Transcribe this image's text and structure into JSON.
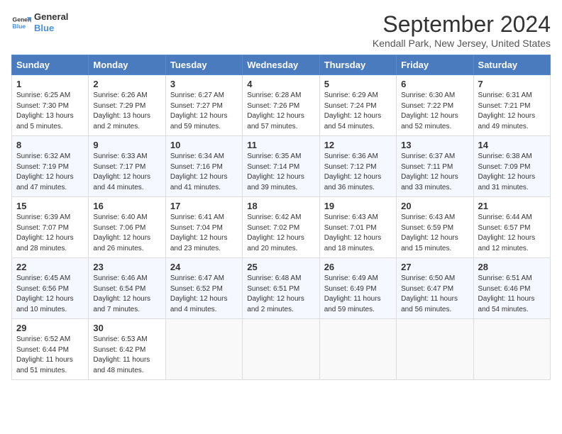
{
  "logo": {
    "line1": "General",
    "line2": "Blue"
  },
  "title": "September 2024",
  "subtitle": "Kendall Park, New Jersey, United States",
  "weekdays": [
    "Sunday",
    "Monday",
    "Tuesday",
    "Wednesday",
    "Thursday",
    "Friday",
    "Saturday"
  ],
  "weeks": [
    [
      {
        "day": "1",
        "info": "Sunrise: 6:25 AM\nSunset: 7:30 PM\nDaylight: 13 hours\nand 5 minutes."
      },
      {
        "day": "2",
        "info": "Sunrise: 6:26 AM\nSunset: 7:29 PM\nDaylight: 13 hours\nand 2 minutes."
      },
      {
        "day": "3",
        "info": "Sunrise: 6:27 AM\nSunset: 7:27 PM\nDaylight: 12 hours\nand 59 minutes."
      },
      {
        "day": "4",
        "info": "Sunrise: 6:28 AM\nSunset: 7:26 PM\nDaylight: 12 hours\nand 57 minutes."
      },
      {
        "day": "5",
        "info": "Sunrise: 6:29 AM\nSunset: 7:24 PM\nDaylight: 12 hours\nand 54 minutes."
      },
      {
        "day": "6",
        "info": "Sunrise: 6:30 AM\nSunset: 7:22 PM\nDaylight: 12 hours\nand 52 minutes."
      },
      {
        "day": "7",
        "info": "Sunrise: 6:31 AM\nSunset: 7:21 PM\nDaylight: 12 hours\nand 49 minutes."
      }
    ],
    [
      {
        "day": "8",
        "info": "Sunrise: 6:32 AM\nSunset: 7:19 PM\nDaylight: 12 hours\nand 47 minutes."
      },
      {
        "day": "9",
        "info": "Sunrise: 6:33 AM\nSunset: 7:17 PM\nDaylight: 12 hours\nand 44 minutes."
      },
      {
        "day": "10",
        "info": "Sunrise: 6:34 AM\nSunset: 7:16 PM\nDaylight: 12 hours\nand 41 minutes."
      },
      {
        "day": "11",
        "info": "Sunrise: 6:35 AM\nSunset: 7:14 PM\nDaylight: 12 hours\nand 39 minutes."
      },
      {
        "day": "12",
        "info": "Sunrise: 6:36 AM\nSunset: 7:12 PM\nDaylight: 12 hours\nand 36 minutes."
      },
      {
        "day": "13",
        "info": "Sunrise: 6:37 AM\nSunset: 7:11 PM\nDaylight: 12 hours\nand 33 minutes."
      },
      {
        "day": "14",
        "info": "Sunrise: 6:38 AM\nSunset: 7:09 PM\nDaylight: 12 hours\nand 31 minutes."
      }
    ],
    [
      {
        "day": "15",
        "info": "Sunrise: 6:39 AM\nSunset: 7:07 PM\nDaylight: 12 hours\nand 28 minutes."
      },
      {
        "day": "16",
        "info": "Sunrise: 6:40 AM\nSunset: 7:06 PM\nDaylight: 12 hours\nand 26 minutes."
      },
      {
        "day": "17",
        "info": "Sunrise: 6:41 AM\nSunset: 7:04 PM\nDaylight: 12 hours\nand 23 minutes."
      },
      {
        "day": "18",
        "info": "Sunrise: 6:42 AM\nSunset: 7:02 PM\nDaylight: 12 hours\nand 20 minutes."
      },
      {
        "day": "19",
        "info": "Sunrise: 6:43 AM\nSunset: 7:01 PM\nDaylight: 12 hours\nand 18 minutes."
      },
      {
        "day": "20",
        "info": "Sunrise: 6:43 AM\nSunset: 6:59 PM\nDaylight: 12 hours\nand 15 minutes."
      },
      {
        "day": "21",
        "info": "Sunrise: 6:44 AM\nSunset: 6:57 PM\nDaylight: 12 hours\nand 12 minutes."
      }
    ],
    [
      {
        "day": "22",
        "info": "Sunrise: 6:45 AM\nSunset: 6:56 PM\nDaylight: 12 hours\nand 10 minutes."
      },
      {
        "day": "23",
        "info": "Sunrise: 6:46 AM\nSunset: 6:54 PM\nDaylight: 12 hours\nand 7 minutes."
      },
      {
        "day": "24",
        "info": "Sunrise: 6:47 AM\nSunset: 6:52 PM\nDaylight: 12 hours\nand 4 minutes."
      },
      {
        "day": "25",
        "info": "Sunrise: 6:48 AM\nSunset: 6:51 PM\nDaylight: 12 hours\nand 2 minutes."
      },
      {
        "day": "26",
        "info": "Sunrise: 6:49 AM\nSunset: 6:49 PM\nDaylight: 11 hours\nand 59 minutes."
      },
      {
        "day": "27",
        "info": "Sunrise: 6:50 AM\nSunset: 6:47 PM\nDaylight: 11 hours\nand 56 minutes."
      },
      {
        "day": "28",
        "info": "Sunrise: 6:51 AM\nSunset: 6:46 PM\nDaylight: 11 hours\nand 54 minutes."
      }
    ],
    [
      {
        "day": "29",
        "info": "Sunrise: 6:52 AM\nSunset: 6:44 PM\nDaylight: 11 hours\nand 51 minutes."
      },
      {
        "day": "30",
        "info": "Sunrise: 6:53 AM\nSunset: 6:42 PM\nDaylight: 11 hours\nand 48 minutes."
      },
      {
        "day": "",
        "info": ""
      },
      {
        "day": "",
        "info": ""
      },
      {
        "day": "",
        "info": ""
      },
      {
        "day": "",
        "info": ""
      },
      {
        "day": "",
        "info": ""
      }
    ]
  ]
}
